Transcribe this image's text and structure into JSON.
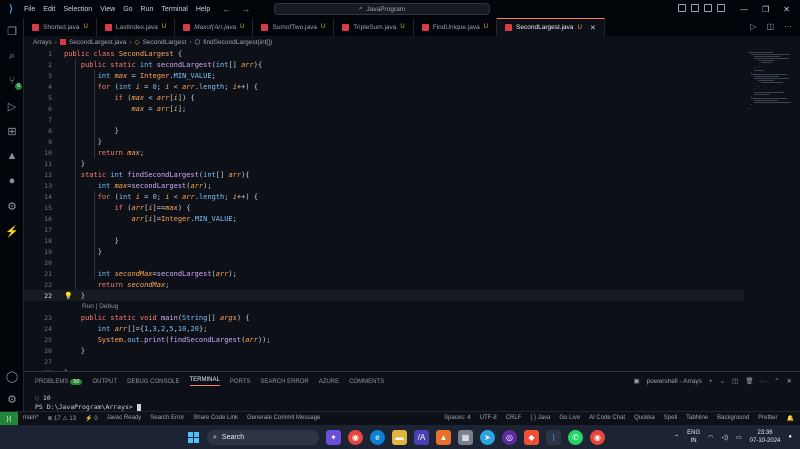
{
  "window": {
    "title": "JavaProgram"
  },
  "menu": [
    "File",
    "Edit",
    "Selection",
    "View",
    "Go",
    "Run",
    "Terminal",
    "Help"
  ],
  "tabs": [
    {
      "label": "Shorted.java",
      "status": "U"
    },
    {
      "label": "LastIndex.java",
      "status": "U"
    },
    {
      "label": "Maxof(Arr.java",
      "status": "U"
    },
    {
      "label": "SumofTwo.java",
      "status": "U"
    },
    {
      "label": "TripleSum.java",
      "status": "U"
    },
    {
      "label": "FindUnique.java",
      "status": "U"
    },
    {
      "label": "SecondLargest.java",
      "status": "U",
      "active": true
    }
  ],
  "breadcrumb": [
    "Arrays",
    "SecondLargest.java",
    "SecondLargest",
    "findSecondLargest(int[])"
  ],
  "editor": {
    "current_line": 22,
    "codelens": "Run | Debug",
    "lines": [
      {
        "n": "1",
        "t": "public class SecondLargest {"
      },
      {
        "n": "2",
        "t": "    public static int secondLargest(int[] arr){"
      },
      {
        "n": "3",
        "t": "        int max = Integer.MIN_VALUE;"
      },
      {
        "n": "4",
        "t": "        for (int i = 0; i < arr.length; i++) {"
      },
      {
        "n": "5",
        "t": "            if (max < arr[i]) {"
      },
      {
        "n": "6",
        "t": "                max = arr[i];"
      },
      {
        "n": "7",
        "t": ""
      },
      {
        "n": "8",
        "t": "            }"
      },
      {
        "n": "9",
        "t": "        }"
      },
      {
        "n": "10",
        "t": "        return max;"
      },
      {
        "n": "11",
        "t": "    }"
      },
      {
        "n": "12",
        "t": "    static int findSecondLargest(int[] arr){"
      },
      {
        "n": "13",
        "t": "        int max=secondLargest(arr);"
      },
      {
        "n": "14",
        "t": "        for (int i = 0; i < arr.length; i++) {"
      },
      {
        "n": "15",
        "t": "            if (arr[i]==max) {"
      },
      {
        "n": "16",
        "t": "                arr[i]=Integer.MIN_VALUE;"
      },
      {
        "n": "17",
        "t": ""
      },
      {
        "n": "18",
        "t": "            }"
      },
      {
        "n": "19",
        "t": "        }"
      },
      {
        "n": "20",
        "t": ""
      },
      {
        "n": "21",
        "t": "        int secondMax=secondLargest(arr);"
      },
      {
        "n": "22",
        "t": "        return secondMax;"
      },
      {
        "n": "22",
        "t": "    }"
      },
      {
        "n": "23",
        "t": "    public static void main(String[] args) {"
      },
      {
        "n": "24",
        "t": "        int arr[]={1,3,2,5,10,20};"
      },
      {
        "n": "25",
        "t": "        System.out.print(findSecondLargest(arr));"
      },
      {
        "n": "26",
        "t": "    }"
      },
      {
        "n": "27",
        "t": ""
      },
      {
        "n": "28",
        "t": "}"
      }
    ]
  },
  "panel": {
    "tabs": [
      "PROBLEMS",
      "OUTPUT",
      "DEBUG CONSOLE",
      "TERMINAL",
      "PORTS",
      "SEARCH ERROR",
      "AZURE",
      "COMMENTS"
    ],
    "problems_count": "50",
    "active_tab": "TERMINAL",
    "terminal_name": "powershell - Arrays",
    "terminal_lines": [
      "10",
      "PS D:\\JavaProgram\\Arrays> "
    ]
  },
  "statusbar": {
    "left": [
      "main*",
      "⊗ 17 ⚠ 13",
      "⚡ 0",
      "Javac Ready",
      "Search Error",
      "Share Code Link",
      "Generate Commit Message"
    ],
    "right": [
      "Spaces: 4",
      "UTF-8",
      "CRLF",
      "{ } Java",
      "Go Live",
      "AI Code Chat",
      "Quokka",
      "Spell",
      "TabNine",
      "Background",
      "Prettier"
    ]
  },
  "taskbar": {
    "search_label": "Search",
    "lang": "ENG",
    "region": "IN",
    "time": "23:36",
    "date": "07-10-2024"
  },
  "colors": {
    "accent": "#238636",
    "tab_active_border": "#f78166",
    "background": "#0d1117"
  }
}
